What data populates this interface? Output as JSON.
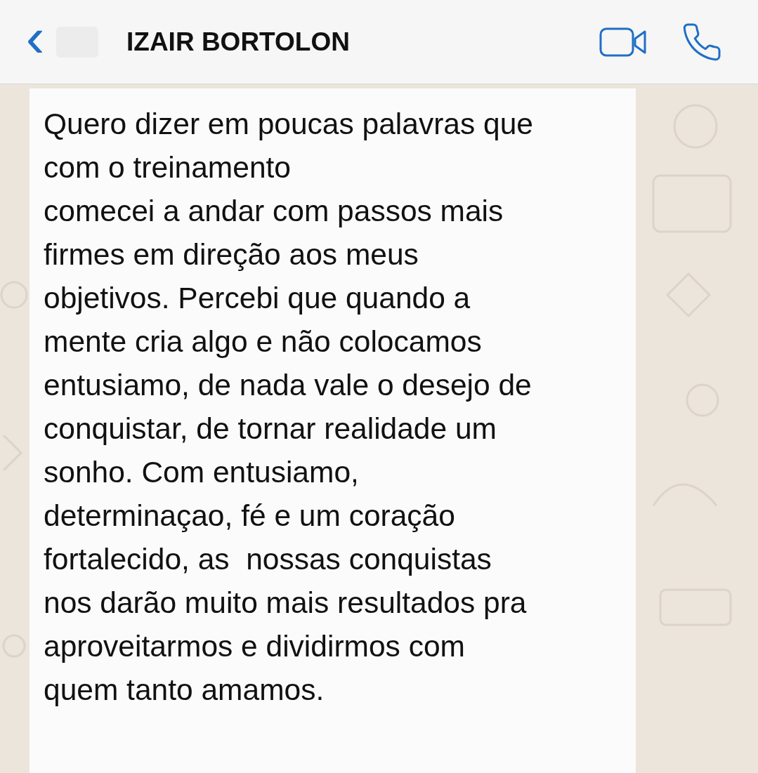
{
  "header": {
    "back": "‹",
    "contact_name": "IZAIR BORTOLON"
  },
  "message": {
    "text": "Quero dizer em poucas palavras que\ncom o treinamento\ncomecei a andar com passos mais\nfirmes em direção aos meus\nobjetivos. Percebi que quando a\nmente cria algo e não colocamos\nentusiamo, de nada vale o desejo de\nconquistar, de tornar realidade um\nsonho. Com entusiamo,\ndeterminaçao, fé e um coração\nfortalecido, as  nossas conquistas\nnos darão muito mais resultados pra\naproveitarmos e dividirmos com\nquem tanto amamos."
  }
}
